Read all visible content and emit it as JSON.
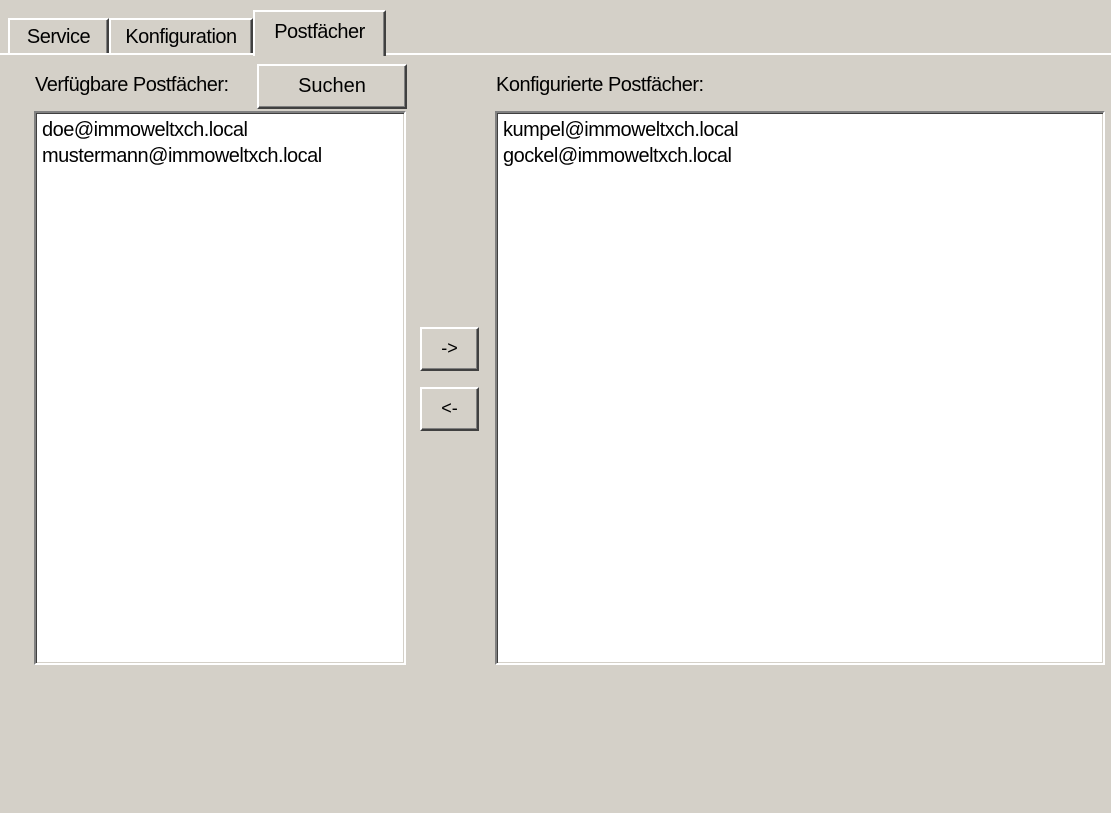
{
  "tabs": [
    {
      "label": "Service"
    },
    {
      "label": "Konfiguration"
    },
    {
      "label": "Postfächer"
    }
  ],
  "active_tab": "Postfächer",
  "available": {
    "label": "Verfügbare Postfächer:",
    "search_button": "Suchen",
    "items": [
      "doe@immoweltxch.local",
      "mustermann@immoweltxch.local"
    ]
  },
  "configured": {
    "label": "Konfigurierte Postfächer:",
    "items": [
      "kumpel@immoweltxch.local",
      "gockel@immoweltxch.local"
    ]
  },
  "move_right_label": "->",
  "move_left_label": "<-"
}
